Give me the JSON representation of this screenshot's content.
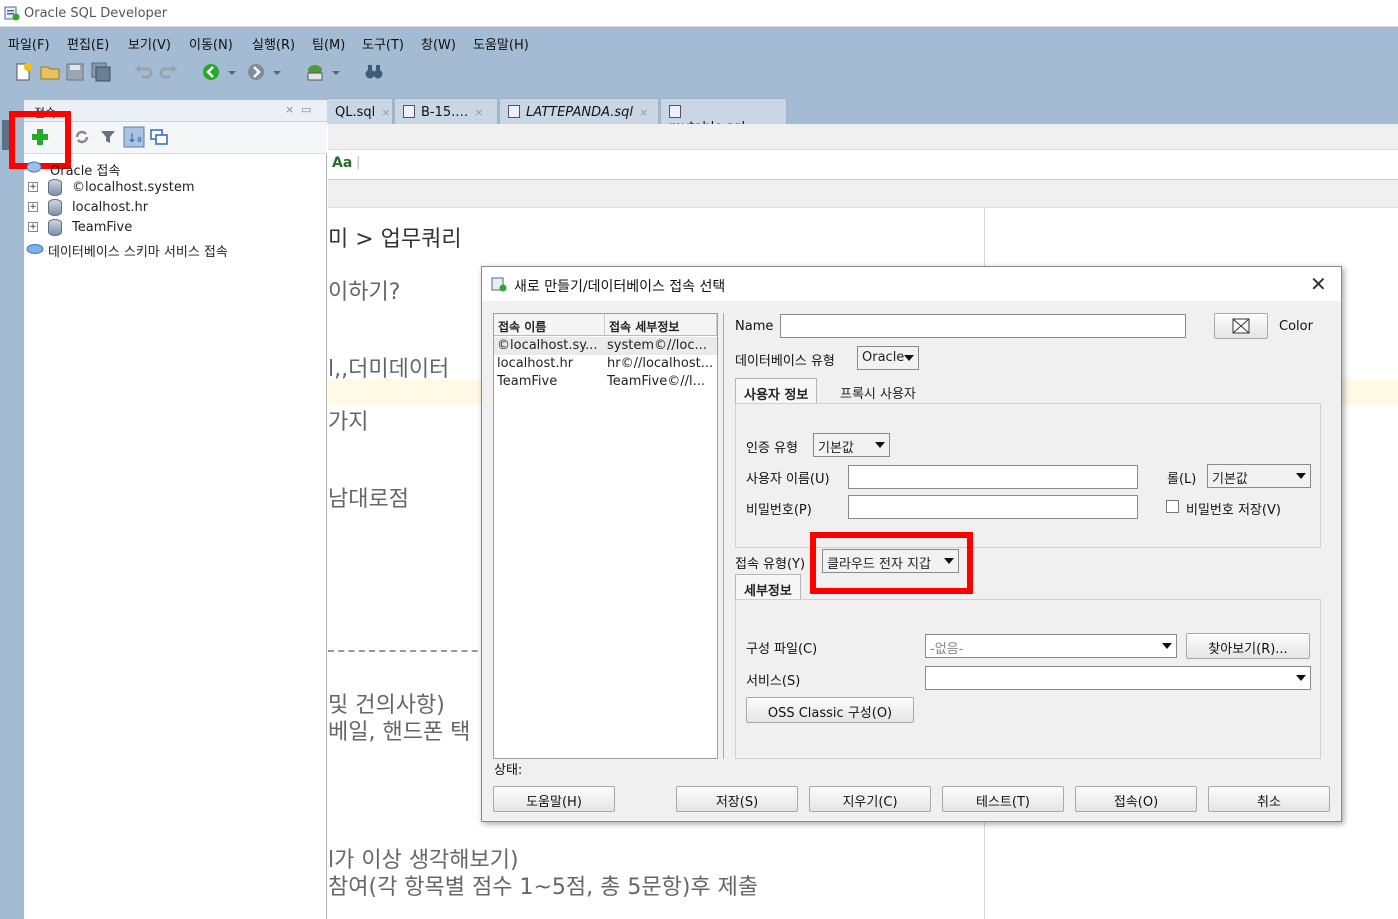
{
  "window": {
    "title": "Oracle SQL Developer"
  },
  "menu": [
    "파일(F)",
    "편집(E)",
    "보기(V)",
    "이동(N)",
    "실행(R)",
    "팀(M)",
    "도구(T)",
    "창(W)",
    "도움말(H)"
  ],
  "doc_tabs": [
    {
      "label": "QL.sql"
    },
    {
      "label": "B-15.…"
    },
    {
      "label": "LATTEPANDA.sql"
    },
    {
      "label": "mytable.sql"
    }
  ],
  "connections_panel": {
    "title": "접속",
    "tree": [
      {
        "label": "Oracle 접속",
        "expandable": false
      },
      {
        "label": "©localhost.system",
        "expandable": true
      },
      {
        "label": "localhost.hr",
        "expandable": true
      },
      {
        "label": "TeamFive",
        "expandable": true
      },
      {
        "label": "데이터베이스 스키마 서비스 접속",
        "expandable": false
      }
    ]
  },
  "editor": {
    "lines": [
      "미 > 업무쿼리",
      "이하기?",
      "l,,더미데이터",
      "가지",
      "남대로점",
      "및 건의사항)",
      "베일, 핸드폰 택",
      "l가 이상 생각해보기)",
      "참여(각 항목별 점수 1~5점, 총 5문항)후 제출"
    ],
    "sql_toolbar_glyph": "Aa"
  },
  "dialog": {
    "title": "새로 만들기/데이터베이스 접속 선택",
    "list": {
      "col1": "접속 이름",
      "col2": "접속 세부정보",
      "rows": [
        {
          "name": "©localhost.sy...",
          "detail": "system©//loc..."
        },
        {
          "name": "localhost.hr",
          "detail": "hr©//localhost..."
        },
        {
          "name": "TeamFive",
          "detail": "TeamFive©//l..."
        }
      ]
    },
    "name_label": "Name",
    "name_value": "",
    "color_label": "Color",
    "db_type_label": "데이터베이스 유형",
    "db_type_value": "Oracle",
    "tabs": [
      "사용자 정보",
      "프록시 사용자"
    ],
    "auth_type_label": "인증 유형",
    "auth_type_value": "기본값",
    "username_label": "사용자 이름(U)",
    "username_value": "",
    "role_label": "롤(L)",
    "role_value": "기본값",
    "password_label": "비밀번호(P)",
    "password_value": "",
    "save_password_label": "비밀번호 저장(V)",
    "save_password_checked": false,
    "conn_type_label": "접속 유형(Y)",
    "conn_type_value": "클라우드 전자 지갑",
    "detail_tab": "세부정보",
    "config_file_label": "구성 파일(C)",
    "config_file_value": "-없음-",
    "browse_button": "찾아보기(R)...",
    "service_label": "서비스(S)",
    "service_value": "",
    "oss_button": "OSS Classic 구성(O)",
    "status_label": "상태:",
    "buttons": {
      "help": "도움말(H)",
      "save": "저장(S)",
      "clear": "지우기(C)",
      "test": "테스트(T)",
      "connect": "접속(O)",
      "cancel": "취소"
    }
  },
  "icons": {
    "app": "sql-developer-icon",
    "add_connection": "green-plus-icon"
  },
  "colors": {
    "chrome_blue": "#a3bbd3",
    "highlight_red": "#ff0000",
    "add_green": "#2aa82a"
  }
}
